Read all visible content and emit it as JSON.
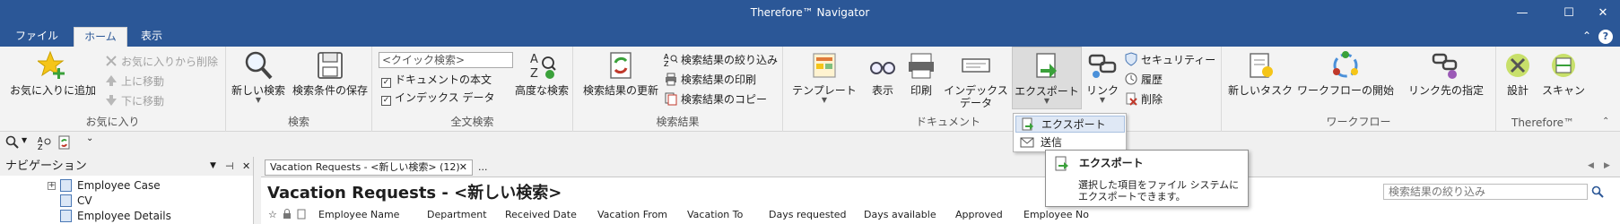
{
  "window": {
    "title": "Therefore™ Navigator",
    "minimize_glyph": "—",
    "maximize_glyph": "☐",
    "close_glyph": "✕"
  },
  "menu_tabs": [
    {
      "label": "ファイル"
    },
    {
      "label": "ホーム"
    },
    {
      "label": "表示"
    }
  ],
  "tabbar_right": {
    "collapse_glyph": "⌃",
    "help_label": "?"
  },
  "ribbon": {
    "favorites": {
      "label": "お気に入り",
      "add_to_favorites": "お気に入りに追加",
      "remove_from_favorites": "お気に入りから削除",
      "move_up": "上に移動",
      "move_down": "下に移動"
    },
    "search": {
      "label": "検索",
      "new_search": "新しい検索",
      "save_search_conditions": "検索条件の保存"
    },
    "fulltext": {
      "label": "全文検索",
      "quick_search_placeholder": "<クイック検索>",
      "document_body": "ドキュメントの本文",
      "index_data": "インデックス データ",
      "advanced_search": "高度な検索"
    },
    "results": {
      "label": "検索結果",
      "refresh_results": "検索結果の更新",
      "filter_results": "検索結果の絞り込み",
      "print_results": "検索結果の印刷",
      "copy_results": "検索結果のコピー"
    },
    "document": {
      "label": "ドキュメント",
      "template": "テンプレート",
      "view": "表示",
      "print": "印刷",
      "index_data_l1": "インデックス",
      "index_data_l2": "データ",
      "export": "エクスポート",
      "link": "リンク",
      "security": "セキュリティー",
      "history": "履歴",
      "delete": "削除"
    },
    "workflow": {
      "label": "ワークフロー",
      "new_task": "新しいタスク",
      "start_workflow": "ワークフローの開始",
      "link_target": "リンク先の指定"
    },
    "therefore": {
      "label": "Therefore™",
      "design": "設計",
      "scan": "スキャン"
    }
  },
  "navigation": {
    "title": "ナビゲーション",
    "pin_glyph": "⊣",
    "close_glyph": "✕",
    "items": [
      {
        "label": "Employee Case"
      },
      {
        "label": "CV"
      },
      {
        "label": "Employee Details"
      }
    ]
  },
  "document_tab": {
    "label": "Vacation Requests - <新しい検索> (12)",
    "close_glyph": "✕",
    "overflow": "..."
  },
  "main": {
    "title": "Vacation Requests - <新しい検索>",
    "filter_placeholder": "検索結果の絞り込み",
    "columns": [
      {
        "label": "Employee Name"
      },
      {
        "label": "Department"
      },
      {
        "label": "Received Date"
      },
      {
        "label": "Vacation From"
      },
      {
        "label": "Vacation To"
      },
      {
        "label": "Days requested"
      },
      {
        "label": "Days available"
      },
      {
        "label": "Approved"
      },
      {
        "label": "Employee No"
      }
    ]
  },
  "export_dropdown": {
    "items": [
      {
        "label": "エクスポート"
      },
      {
        "label": "送信"
      }
    ]
  },
  "tooltip": {
    "title": "エクスポート",
    "description": "選択した項目をファイル システムにエクスポートできます。"
  },
  "colors": {
    "titlebar": "#2b5797",
    "ribbon": "#f3f3f3",
    "accent_green": "#3aa13a",
    "accent_red": "#c0392b"
  }
}
